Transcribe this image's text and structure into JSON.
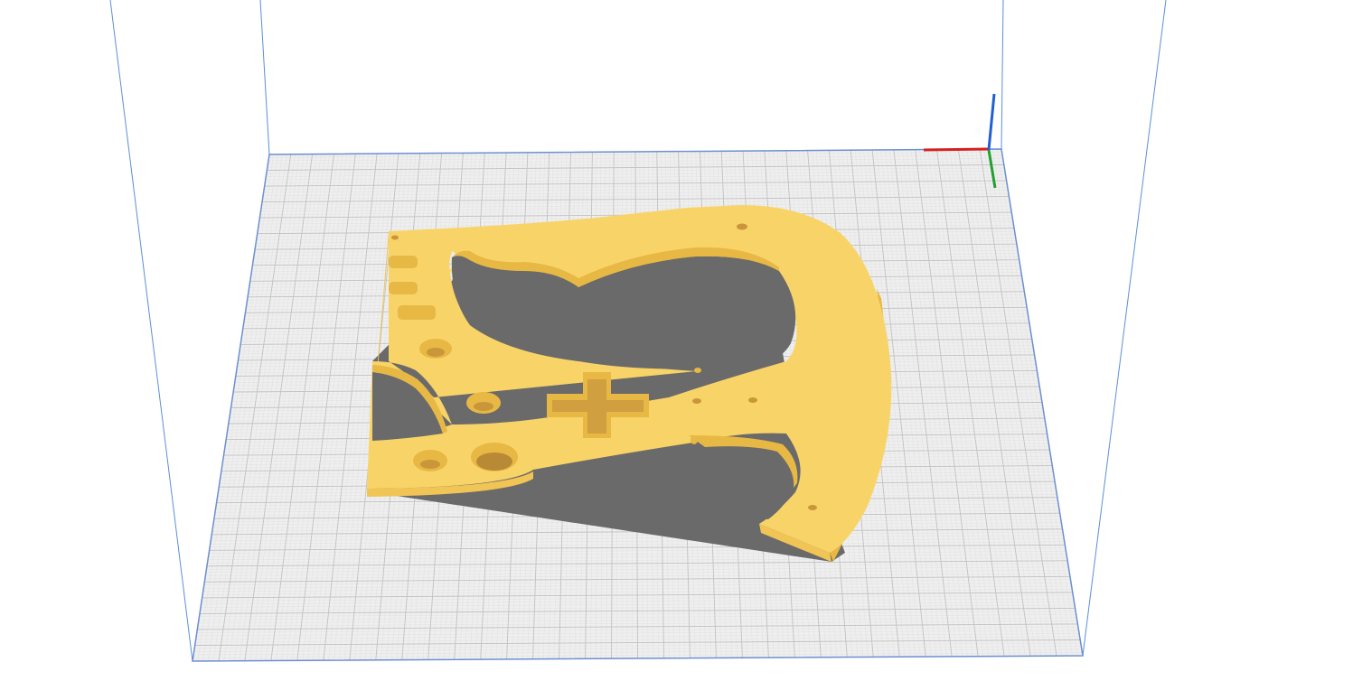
{
  "viewport": {
    "background_color": "#ffffff"
  },
  "build_plate": {
    "surface_color": "#efefef",
    "grid_color": "#c2c2c2",
    "grid_fine_color": "#dddddd",
    "edge_color": "#6b8fd0"
  },
  "build_volume": {
    "frame_color": "#5b8fd8"
  },
  "model": {
    "top_color": "#f8d468",
    "side_color": "#f0c455",
    "hole_wall_color": "#e8b845",
    "shadow_color": "#6a6a6a",
    "shadow_lighter_color": "#7a7a7a"
  },
  "axes": {
    "x_color": "#d42020",
    "y_color": "#22a030",
    "z_color": "#2060d0"
  }
}
